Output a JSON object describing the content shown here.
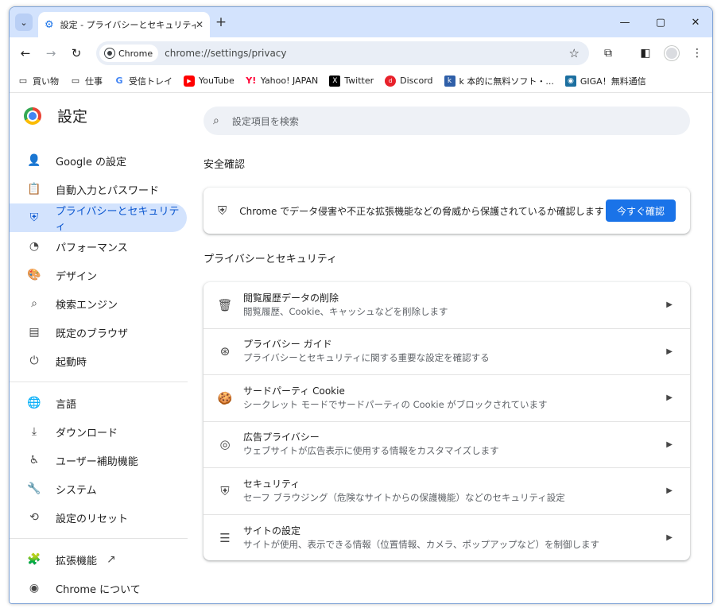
{
  "tab": {
    "title": "設定 - プライバシーとセキュリティ",
    "close": "✕",
    "new_tab": "+"
  },
  "window_controls": {
    "minimize": "—",
    "maximize": "▢",
    "close": "✕"
  },
  "omnibox": {
    "chip_label": "Chrome",
    "url": "chrome://settings/privacy"
  },
  "bookmarks": [
    {
      "label": "買い物",
      "icon": "folder-icon"
    },
    {
      "label": "仕事",
      "icon": "folder-icon"
    },
    {
      "label": "受信トレイ",
      "icon": "google-icon"
    },
    {
      "label": "YouTube",
      "icon": "youtube-icon"
    },
    {
      "label": "Yahoo! JAPAN",
      "icon": "yahoo-icon"
    },
    {
      "label": "Twitter",
      "icon": "x-icon"
    },
    {
      "label": "Discord",
      "icon": "discord-icon"
    },
    {
      "label": "k 本的に無料ソフト・...",
      "icon": "k-icon"
    },
    {
      "label": "GIGA！無料通信",
      "icon": "giga-icon"
    }
  ],
  "settings": {
    "title": "設定",
    "search_placeholder": "設定項目を検索"
  },
  "sidebar": {
    "items": [
      {
        "label": "Google の設定",
        "icon": "person-icon"
      },
      {
        "label": "自動入力とパスワード",
        "icon": "clipboard-icon"
      },
      {
        "label": "プライバシーとセキュリティ",
        "icon": "shield-icon",
        "active": true
      },
      {
        "label": "パフォーマンス",
        "icon": "speedometer-icon"
      },
      {
        "label": "デザイン",
        "icon": "palette-icon"
      },
      {
        "label": "検索エンジン",
        "icon": "search-icon"
      },
      {
        "label": "既定のブラウザ",
        "icon": "browser-icon"
      },
      {
        "label": "起動時",
        "icon": "power-icon"
      }
    ],
    "items2": [
      {
        "label": "言語",
        "icon": "globe-icon"
      },
      {
        "label": "ダウンロード",
        "icon": "download-icon"
      },
      {
        "label": "ユーザー補助機能",
        "icon": "accessibility-icon"
      },
      {
        "label": "システム",
        "icon": "wrench-icon"
      },
      {
        "label": "設定のリセット",
        "icon": "reset-icon"
      }
    ],
    "items3": [
      {
        "label": "拡張機能",
        "icon": "puzzle-icon"
      },
      {
        "label": "Chrome について",
        "icon": "chrome-icon"
      }
    ]
  },
  "safety_check": {
    "heading": "安全確認",
    "text": "Chrome でデータ侵害や不正な拡張機能などの脅威から保護されているか確認します",
    "button": "今すぐ確認"
  },
  "privacy": {
    "heading": "プライバシーとセキュリティ",
    "rows": [
      {
        "title": "閲覧履歴データの削除",
        "subtitle": "閲覧履歴、Cookie、キャッシュなどを削除します",
        "icon": "trash-icon"
      },
      {
        "title": "プライバシー ガイド",
        "subtitle": "プライバシーとセキュリティに関する重要な設定を確認する",
        "icon": "compass-icon"
      },
      {
        "title": "サードパーティ Cookie",
        "subtitle": "シークレット モードでサードパーティの Cookie がブロックされています",
        "icon": "cookie-icon"
      },
      {
        "title": "広告プライバシー",
        "subtitle": "ウェブサイトが広告表示に使用する情報をカスタマイズします",
        "icon": "ad-privacy-icon"
      },
      {
        "title": "セキュリティ",
        "subtitle": "セーフ ブラウジング（危険なサイトからの保護機能）などのセキュリティ設定",
        "icon": "security-shield-icon"
      },
      {
        "title": "サイトの設定",
        "subtitle": "サイトが使用、表示できる情報（位置情報、カメラ、ポップアップなど）を制御します",
        "icon": "tune-icon"
      }
    ]
  },
  "colors": {
    "accent": "#1a73e8",
    "active_bg": "#d3e3fd",
    "active_text": "#0b57d0",
    "tabbar": "#d3e3fd"
  }
}
